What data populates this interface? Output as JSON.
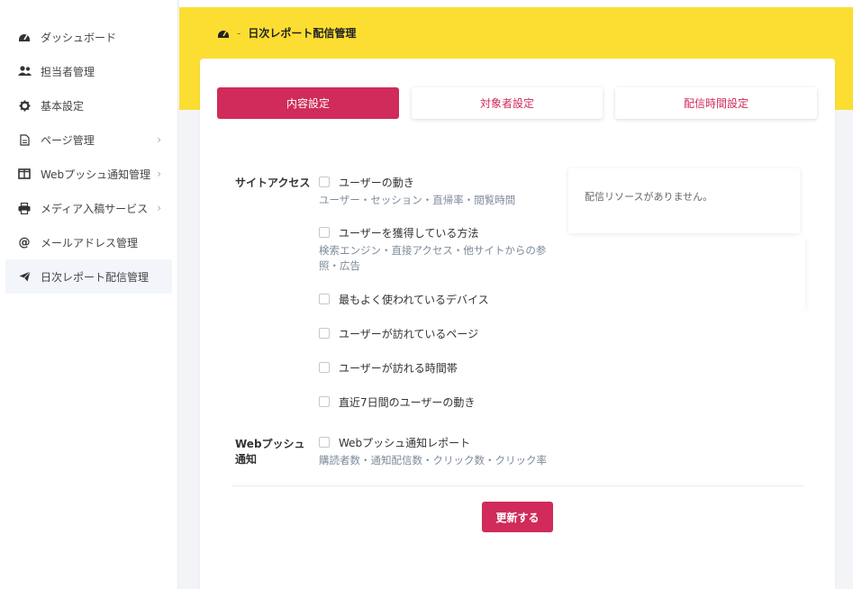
{
  "sidebar": {
    "items": [
      {
        "label": "ダッシュボード",
        "icon": "dashboard-icon",
        "has_chevron": false
      },
      {
        "label": "担当者管理",
        "icon": "users-icon",
        "has_chevron": false
      },
      {
        "label": "基本設定",
        "icon": "gear-icon",
        "has_chevron": false
      },
      {
        "label": "ページ管理",
        "icon": "document-icon",
        "has_chevron": true
      },
      {
        "label": "Webプッシュ通知管理",
        "icon": "window-icon",
        "has_chevron": true
      },
      {
        "label": "メディア入稿サービス",
        "icon": "printer-icon",
        "has_chevron": true
      },
      {
        "label": "メールアドレス管理",
        "icon": "at-icon",
        "has_chevron": false
      },
      {
        "label": "日次レポート配信管理",
        "icon": "paper-plane-icon",
        "has_chevron": false,
        "active": true
      }
    ]
  },
  "breadcrumb": {
    "sep": "-",
    "current": "日次レポート配信管理"
  },
  "tabs": [
    {
      "label": "内容設定",
      "active": true
    },
    {
      "label": "対象者設定",
      "active": false
    },
    {
      "label": "配信時間設定",
      "active": false
    }
  ],
  "sections": {
    "site_access": {
      "label": "サイトアクセス",
      "options": [
        {
          "label": "ユーザーの動き",
          "desc": "ユーザー・セッション・直帰率・閲覧時間"
        },
        {
          "label": "ユーザーを獲得している方法",
          "desc": "検索エンジン・直接アクセス・他サイトからの参照・広告"
        },
        {
          "label": "最もよく使われているデバイス",
          "desc": ""
        },
        {
          "label": "ユーザーが訪れているページ",
          "desc": ""
        },
        {
          "label": "ユーザーが訪れる時間帯",
          "desc": ""
        },
        {
          "label": "直近7日間のユーザーの動き",
          "desc": ""
        }
      ]
    },
    "web_push": {
      "label": "Webプッシュ通知",
      "options": [
        {
          "label": "Webプッシュ通知レポート",
          "desc": "購読者数・通知配信数・クリック数・クリック率"
        }
      ]
    }
  },
  "resource_panel": {
    "message": "配信リソースがありません。"
  },
  "submit": {
    "label": "更新する"
  },
  "colors": {
    "accent": "#d02b5a",
    "header_band": "#fcde32",
    "muted_text": "#7d8a99"
  }
}
